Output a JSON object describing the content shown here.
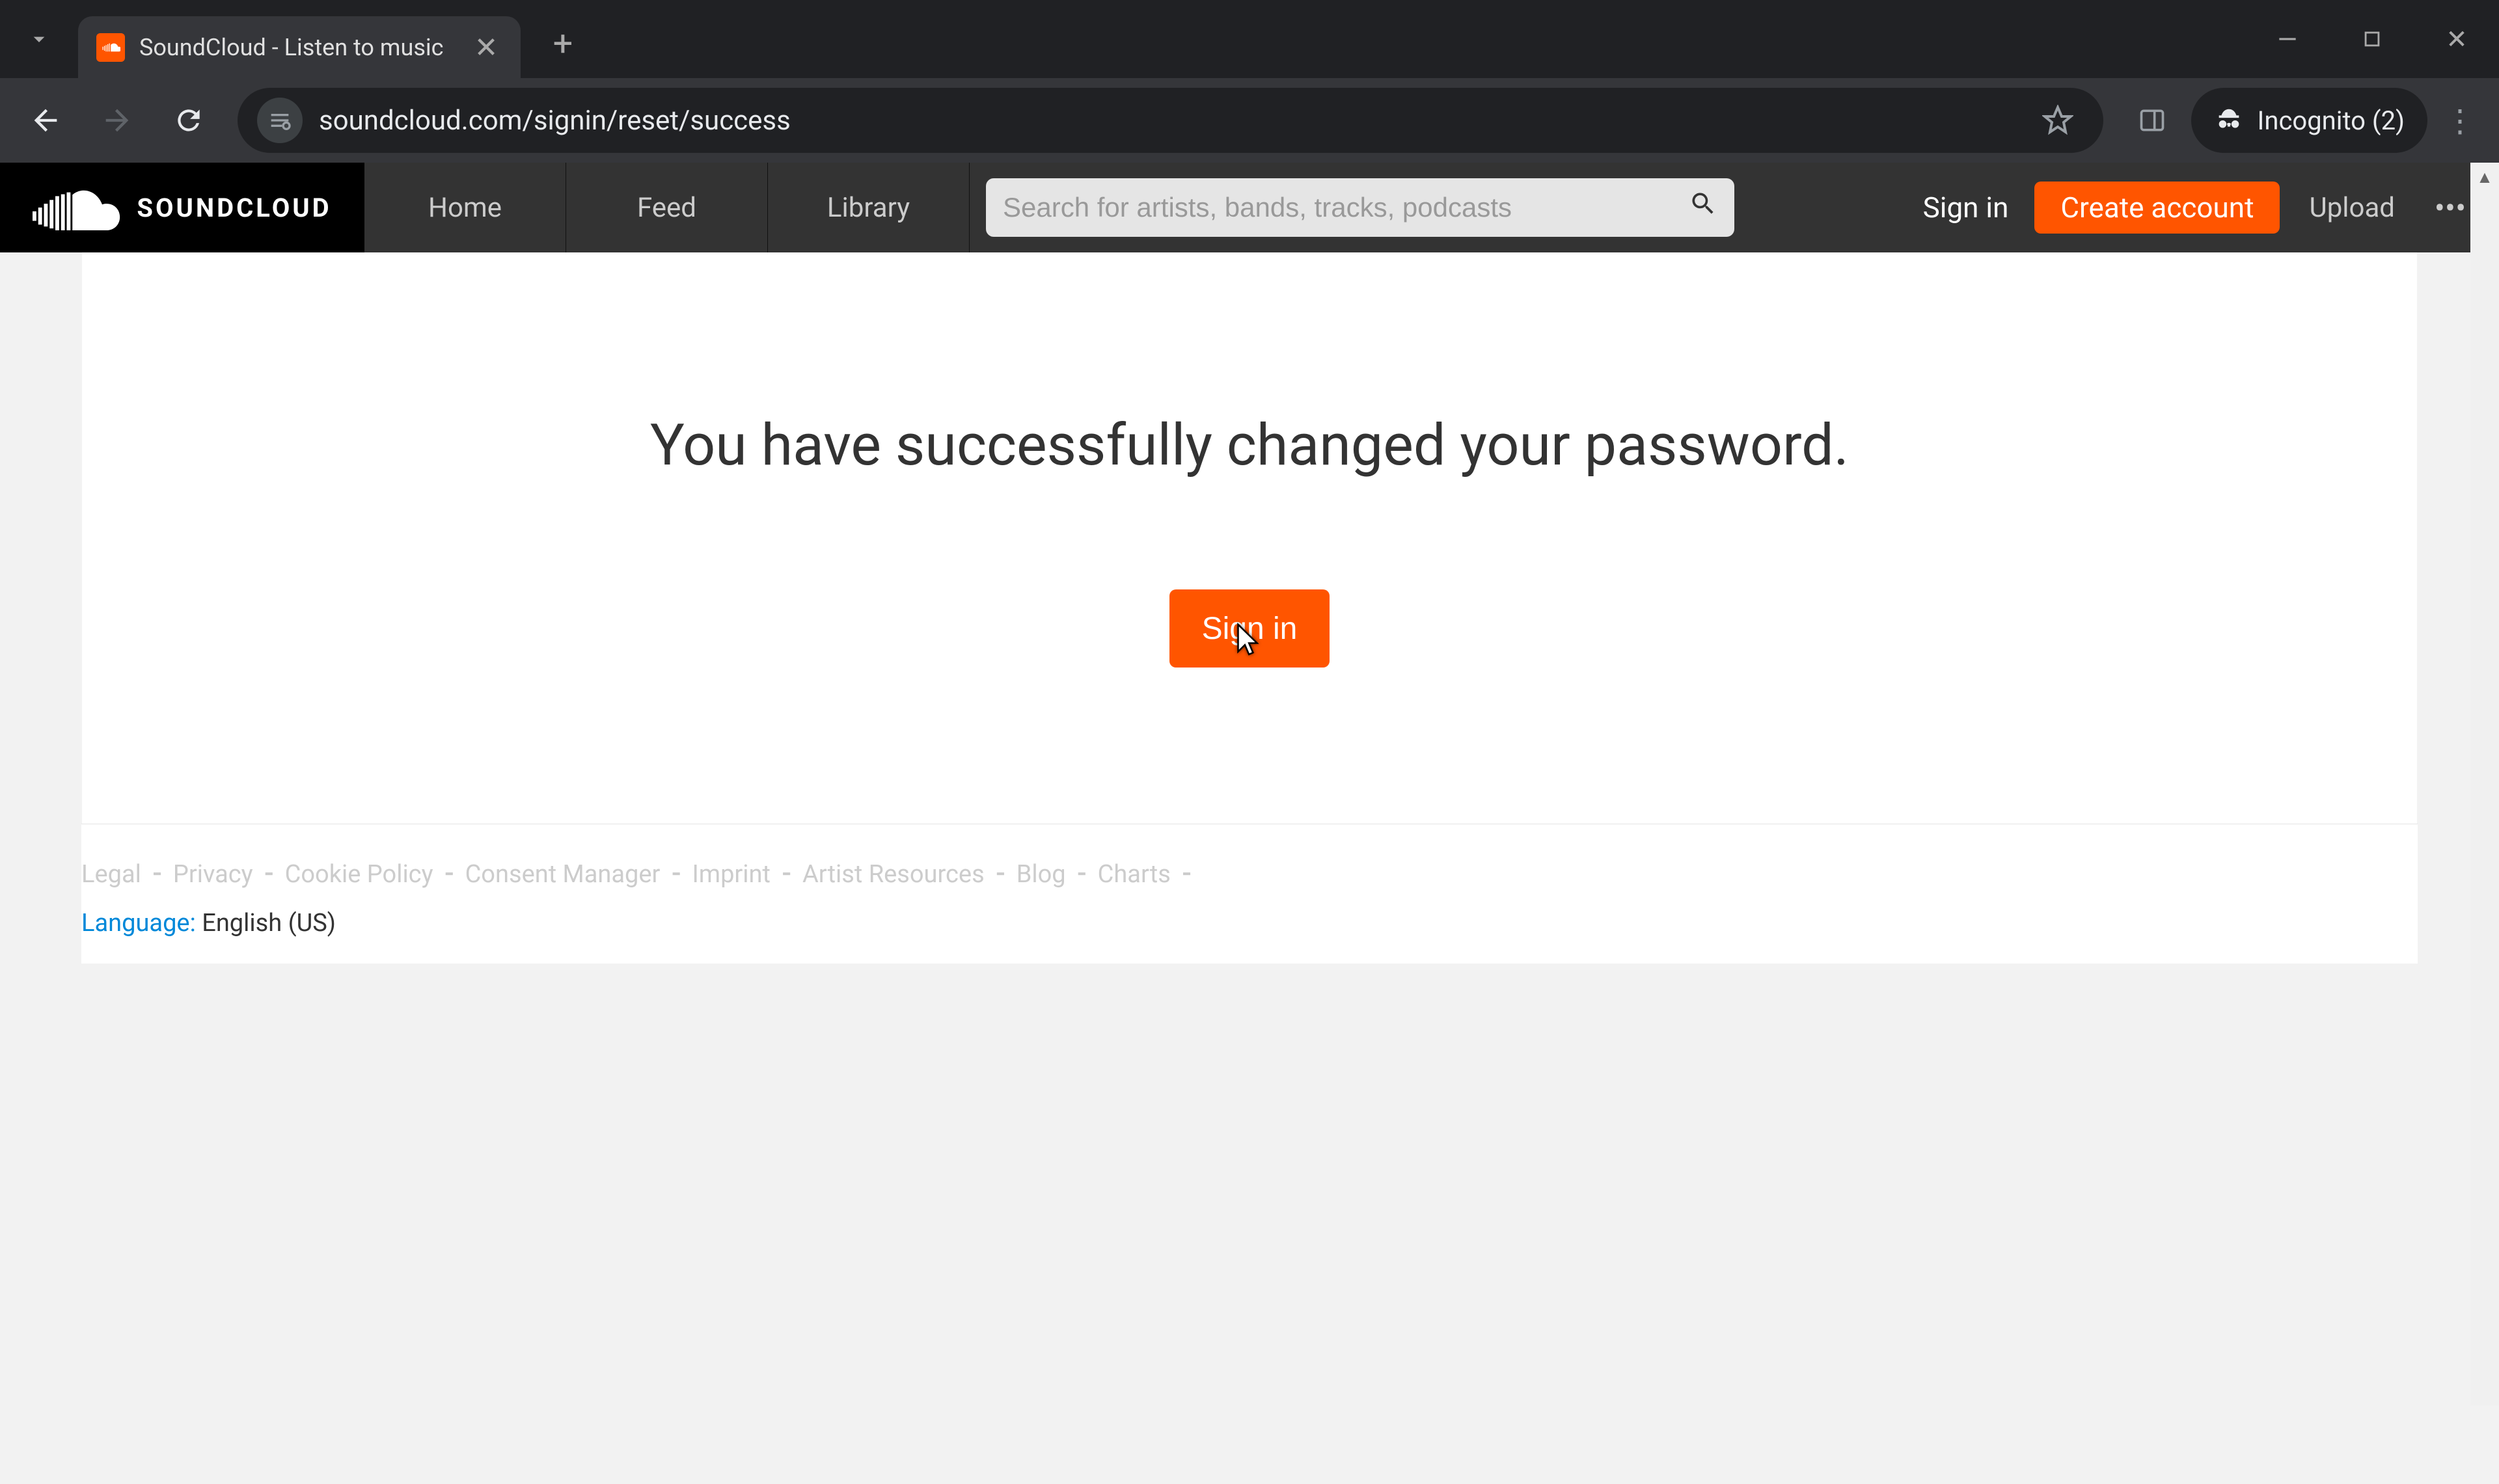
{
  "browser": {
    "tab_title": "SoundCloud - Listen to music",
    "url": "soundcloud.com/signin/reset/success",
    "incognito_label": "Incognito (2)"
  },
  "header": {
    "logo_text": "SOUNDCLOUD",
    "nav": {
      "home": "Home",
      "feed": "Feed",
      "library": "Library"
    },
    "search_placeholder": "Search for artists, bands, tracks, podcasts",
    "sign_in": "Sign in",
    "create_account": "Create account",
    "upload": "Upload"
  },
  "main": {
    "heading": "You have successfully changed your password.",
    "sign_in_button": "Sign in"
  },
  "footer": {
    "links": [
      "Legal",
      "Privacy",
      "Cookie Policy",
      "Consent Manager",
      "Imprint",
      "Artist Resources",
      "Blog",
      "Charts"
    ],
    "language_label": "Language:",
    "language_value": "English (US)"
  },
  "colors": {
    "accent": "#ff5500",
    "link": "#0088d9"
  }
}
